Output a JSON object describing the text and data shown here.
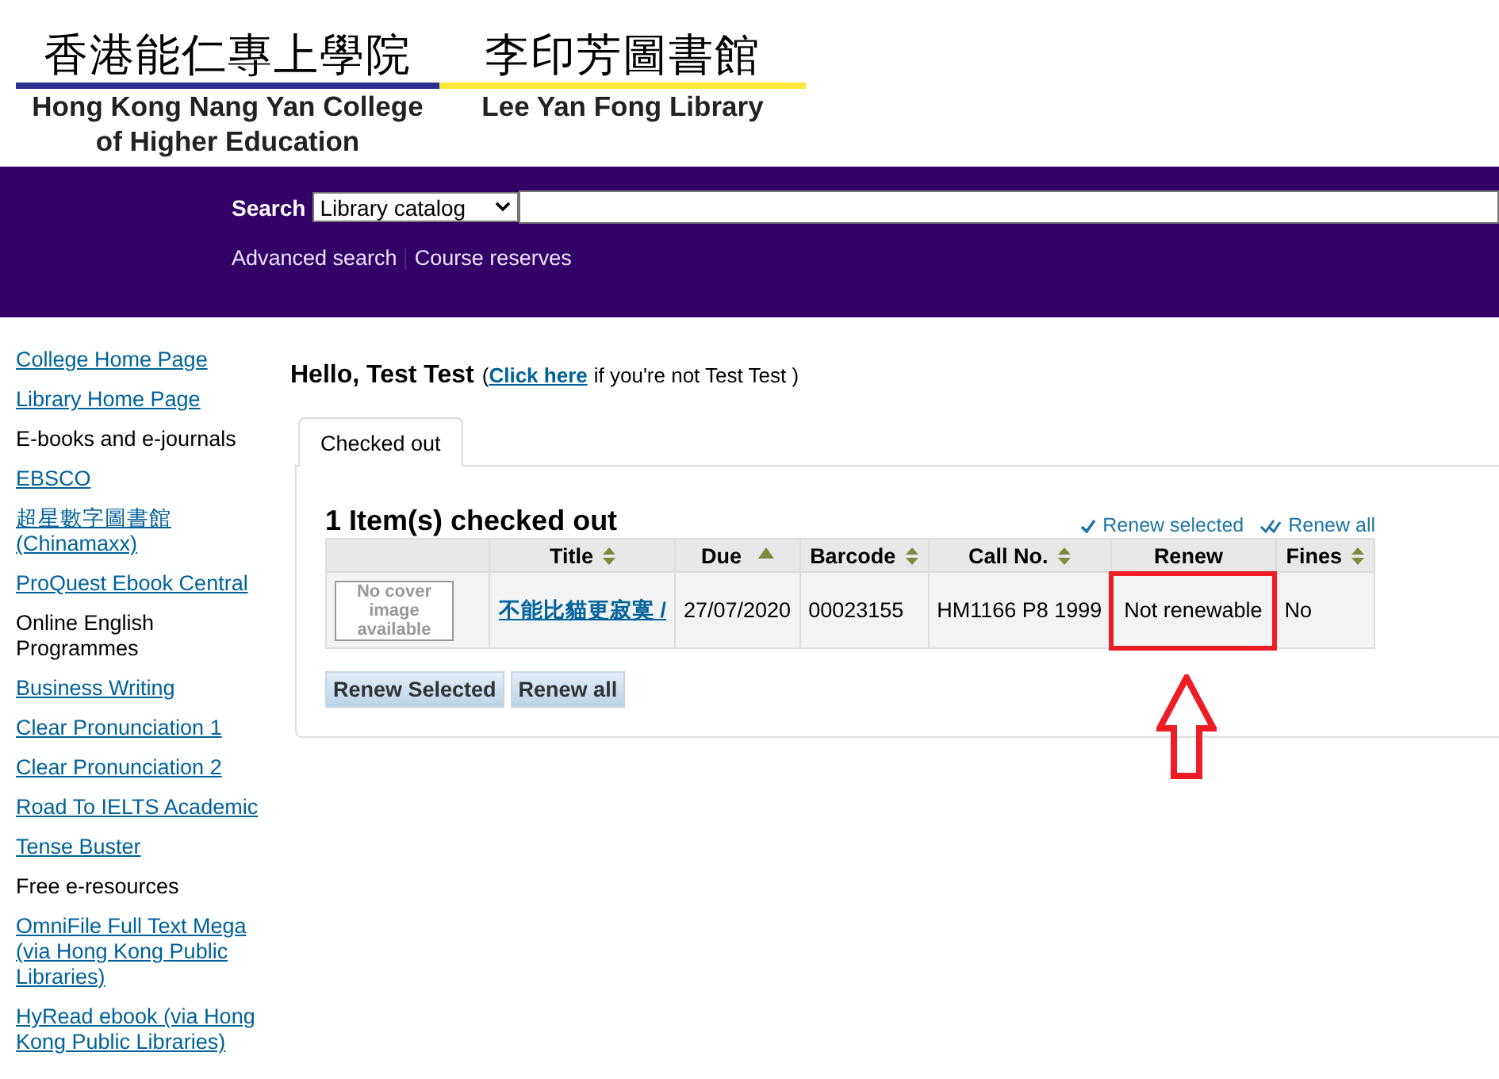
{
  "logo": {
    "left": {
      "chinese": "香港能仁專上學院",
      "english": "Hong Kong Nang Yan College of Higher Education",
      "color": "#2e3192"
    },
    "right": {
      "chinese": "李印芳圖書館",
      "english": "Lee Yan Fong Library",
      "color": "#ffe63b"
    }
  },
  "search": {
    "label": "Search",
    "scope": "Library catalog",
    "links": [
      "Advanced search",
      "Course reserves"
    ]
  },
  "sidebar": {
    "items": [
      {
        "label": "College Home Page",
        "kind": "link"
      },
      {
        "label": "Library Home Page",
        "kind": "link"
      },
      {
        "label": "E-books and e-journals",
        "kind": "heading"
      },
      {
        "label": "EBSCO",
        "kind": "link"
      },
      {
        "label": "超星數字圖書館 (Chinamaxx)",
        "kind": "link"
      },
      {
        "label": "ProQuest Ebook Central",
        "kind": "link"
      },
      {
        "label": "Online English Programmes",
        "kind": "heading"
      },
      {
        "label": "Business Writing",
        "kind": "link"
      },
      {
        "label": "Clear Pronunciation 1",
        "kind": "link"
      },
      {
        "label": "Clear Pronunciation 2",
        "kind": "link"
      },
      {
        "label": "Road To IELTS Academic",
        "kind": "link"
      },
      {
        "label": "Tense Buster",
        "kind": "link"
      },
      {
        "label": "Free e-resources",
        "kind": "heading"
      },
      {
        "label": "OmniFile Full Text Mega (via Hong Kong Public Libraries)",
        "kind": "link"
      },
      {
        "label": "HyRead ebook (via Hong Kong Public Libraries)",
        "kind": "link"
      }
    ]
  },
  "greeting": {
    "hello": "Hello, Test Test",
    "open_paren": "(",
    "link": "Click here",
    "rest": "if you're not Test Test )"
  },
  "tabs": [
    {
      "label": "Checked out",
      "selected": true
    }
  ],
  "checkouts": {
    "heading": "1 Item(s) checked out",
    "actions": [
      "Renew selected",
      "Renew all"
    ],
    "columns": [
      {
        "sortable": false
      },
      {
        "label": "Title",
        "sortable": true,
        "sorted_ascending": false
      },
      {
        "label": "Due",
        "sortable": true,
        "sorted_ascending": true
      },
      {
        "label": "Barcode",
        "sortable": true,
        "sorted_ascending": false
      },
      {
        "label": "Call No.",
        "sortable": true,
        "sorted_ascending": false
      },
      {
        "label": "Renew",
        "sortable": false
      },
      {
        "label": "Fines",
        "sortable": true,
        "sorted_ascending": false
      }
    ],
    "rows": [
      {
        "cover": "No cover image available",
        "title": "不能比貓更寂寞 /",
        "due": "27/07/2020",
        "barcode": "00023155",
        "call_no": "HM1166 P8 1999",
        "renew": "Not renewable",
        "fines": "No",
        "renew_highlighted": true
      }
    ],
    "buttons": [
      "Renew Selected",
      "Renew all"
    ]
  }
}
